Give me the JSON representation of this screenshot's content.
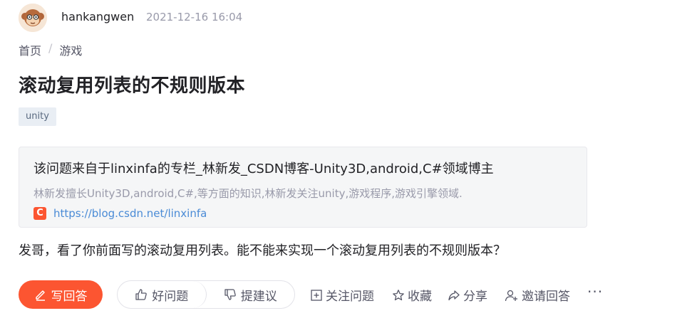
{
  "header": {
    "author": "hankangwen",
    "time": "2021-12-16 16:04"
  },
  "breadcrumb": {
    "items": [
      "首页",
      "游戏"
    ],
    "separator": "/"
  },
  "question": {
    "title": "滚动复用列表的不规则版本",
    "tag": "unity",
    "body": "发哥，看了你前面写的滚动复用列表。能不能来实现一个滚动复用列表的不规则版本？"
  },
  "source_card": {
    "title": "该问题来自于linxinfa的专栏_林新发_CSDN博客-Unity3D,android,C#领域博主",
    "description": "林新发擅长Unity3D,android,C#,等方面的知识,林新发关注unity,游戏程序,游戏引擎领域.",
    "logo_letter": "C",
    "url": "https://blog.csdn.net/linxinfa"
  },
  "actions": {
    "answer": "写回答",
    "good_question": "好问题",
    "suggest": "提建议",
    "follow": "关注问题",
    "collect": "收藏",
    "share": "分享",
    "invite": "邀请回答",
    "more": "···"
  },
  "colors": {
    "brand": "#fc5531",
    "link": "#4a8bd6",
    "muted": "#999aaa"
  }
}
